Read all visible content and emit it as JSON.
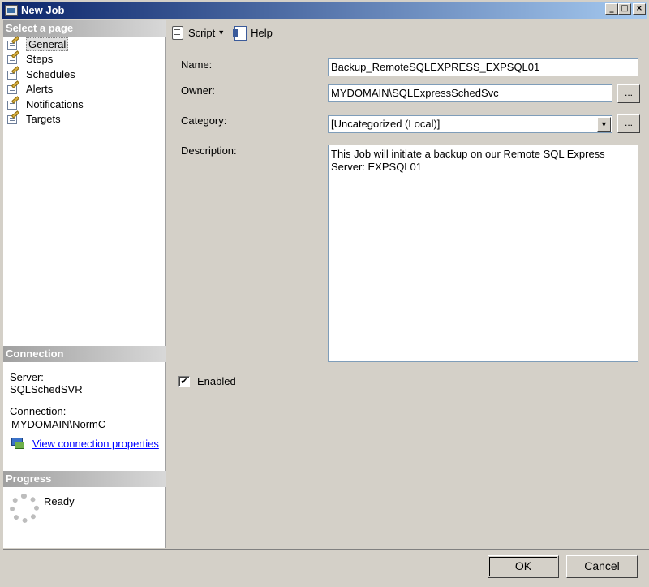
{
  "window": {
    "title": "New Job"
  },
  "title_buttons": {
    "minimize": "_",
    "maximize": "□",
    "close": "×"
  },
  "left_pane": {
    "select_page_header": "Select a page",
    "pages": [
      {
        "label": "General",
        "selected": true
      },
      {
        "label": "Steps"
      },
      {
        "label": "Schedules"
      },
      {
        "label": "Alerts"
      },
      {
        "label": "Notifications"
      },
      {
        "label": "Targets"
      }
    ],
    "connection_header": "Connection",
    "server_label": "Server:",
    "server_value": "SQLSchedSVR",
    "connection_label": "Connection:",
    "connection_value": "MYDOMAIN\\NormC",
    "view_connection_link": "View connection properties",
    "progress_header": "Progress",
    "progress_status": "Ready"
  },
  "toolbar": {
    "script_label": "Script",
    "help_label": "Help"
  },
  "form": {
    "name_label": "Name:",
    "name_value": "Backup_RemoteSQLEXPRESS_EXPSQL01",
    "owner_label": "Owner:",
    "owner_value": "MYDOMAIN\\SQLExpressSchedSvc",
    "category_label": "Category:",
    "category_value": "[Uncategorized (Local)]",
    "description_label": "Description:",
    "description_value": "This Job will initiate a backup on our Remote SQL Express Server: EXPSQL01",
    "enabled_label": "Enabled",
    "enabled_checked": true,
    "browse_button": "..."
  },
  "buttons": {
    "ok": "OK",
    "cancel": "Cancel"
  }
}
